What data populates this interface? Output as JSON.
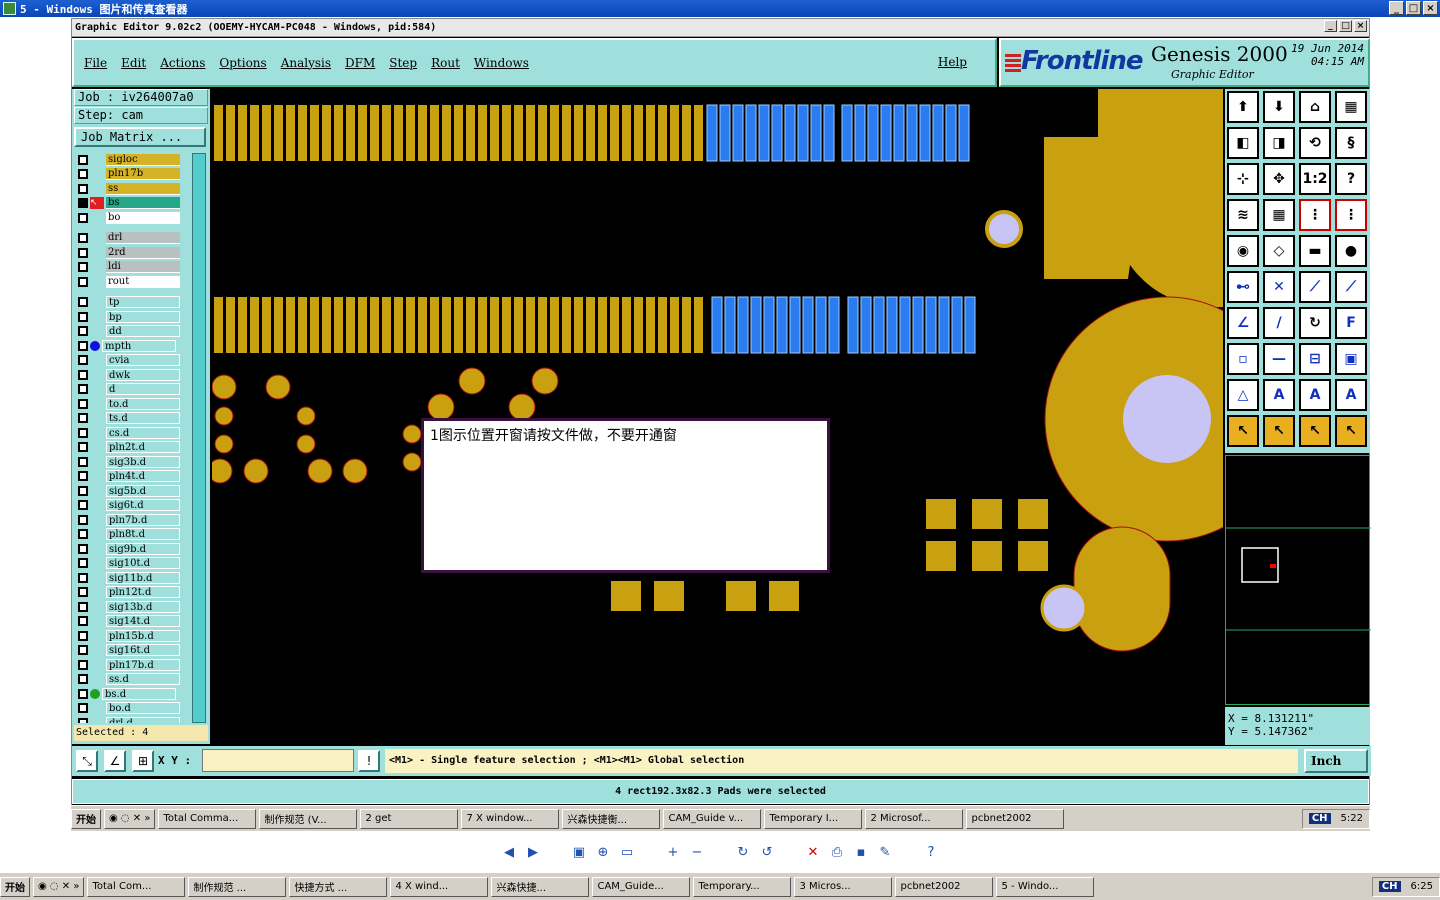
{
  "viewer": {
    "title": "5 - Windows 图片和传真查看器"
  },
  "app": {
    "title": "Graphic Editor 9.02c2  (OOEMY-HYCAM-PC048 - Windows, pid:584)",
    "menu": [
      "File",
      "Edit",
      "Actions",
      "Options",
      "Analysis",
      "DFM",
      "Step",
      "Rout",
      "Windows"
    ],
    "help": "Help",
    "logo": "Frontline",
    "product": "Genesis 2000",
    "product_sub": "Graphic Editor",
    "date": "19 Jun 2014",
    "time": "04:15 AM"
  },
  "job": {
    "job": "Job  :  iv264007a0",
    "step": "Step:  cam",
    "matrix_button": "Job Matrix ..."
  },
  "layers": [
    {
      "name": "sigloc",
      "style": "olive"
    },
    {
      "name": "pln17b",
      "style": "olive"
    },
    {
      "name": "ss",
      "style": "olive"
    },
    {
      "name": "bs",
      "style": "teal"
    },
    {
      "name": "bo",
      "style": "white"
    },
    {
      "name": "drl",
      "style": "gray"
    },
    {
      "name": "2rd",
      "style": "gray"
    },
    {
      "name": "ldi",
      "style": "gray"
    },
    {
      "name": "rout",
      "style": "white"
    },
    {
      "name": "tp",
      "style": "cyan"
    },
    {
      "name": "bp",
      "style": "cyan"
    },
    {
      "name": "dd",
      "style": "cyan"
    },
    {
      "name": "mpth",
      "style": "cyan"
    },
    {
      "name": "cvia",
      "style": "cyan"
    },
    {
      "name": "dwk",
      "style": "cyan"
    },
    {
      "name": "d",
      "style": "cyan"
    },
    {
      "name": "to.d",
      "style": "cyan"
    },
    {
      "name": "ts.d",
      "style": "cyan"
    },
    {
      "name": "cs.d",
      "style": "cyan"
    },
    {
      "name": "pln2t.d",
      "style": "cyan"
    },
    {
      "name": "sig3b.d",
      "style": "cyan"
    },
    {
      "name": "pln4t.d",
      "style": "cyan"
    },
    {
      "name": "sig5b.d",
      "style": "cyan"
    },
    {
      "name": "sig6t.d",
      "style": "cyan"
    },
    {
      "name": "pln7b.d",
      "style": "cyan"
    },
    {
      "name": "pln8t.d",
      "style": "cyan"
    },
    {
      "name": "sig9b.d",
      "style": "cyan"
    },
    {
      "name": "sig10t.d",
      "style": "cyan"
    },
    {
      "name": "sig11b.d",
      "style": "cyan"
    },
    {
      "name": "pln12t.d",
      "style": "cyan"
    },
    {
      "name": "sig13b.d",
      "style": "cyan"
    },
    {
      "name": "sig14t.d",
      "style": "cyan"
    },
    {
      "name": "pln15b.d",
      "style": "cyan"
    },
    {
      "name": "sig16t.d",
      "style": "cyan"
    },
    {
      "name": "pln17b.d",
      "style": "cyan"
    },
    {
      "name": "ss.d",
      "style": "cyan"
    },
    {
      "name": "bs.d",
      "style": "cyan"
    },
    {
      "name": "bo.d",
      "style": "cyan"
    },
    {
      "name": "drl.d",
      "style": "cyan"
    }
  ],
  "selected": "Selected : 4",
  "note": "1图示位置开窗请按文件做，不要开通窗",
  "coords": {
    "x": "X  =  8.131211\"",
    "y": "Y  =  5.147362\""
  },
  "bottom": {
    "xy_label": "X Y :",
    "hint": "<M1> - Single feature selection ; <M1><M1> Global selection",
    "unit": "Inch",
    "status": "4 rect192.3x82.3 Pads were selected"
  },
  "inner_taskbar": {
    "start": "开始",
    "items": [
      "Total Comma...",
      "制作规范 (V...",
      "2 get",
      "7 X window...",
      "兴森快捷衡...",
      "CAM_Guide v...",
      "Temporary I...",
      "2 Microsof...",
      "pcbnet2002"
    ],
    "lang": "CH",
    "time": "5:22"
  },
  "outer_taskbar": {
    "start": "开始",
    "items": [
      "Total Com...",
      "制作规范 ...",
      "快捷方式 ...",
      "4 X wind...",
      "兴森快捷...",
      "CAM_Guide...",
      "Temporary...",
      "3 Micros...",
      "pcbnet2002",
      "5 - Windo..."
    ],
    "lang": "CH",
    "time": "6:25"
  },
  "colors": {
    "cyan": "#9fe0dc",
    "olive": "#c9a010",
    "blue": "#2a7cf0",
    "lavender": "#c8c4f4"
  }
}
